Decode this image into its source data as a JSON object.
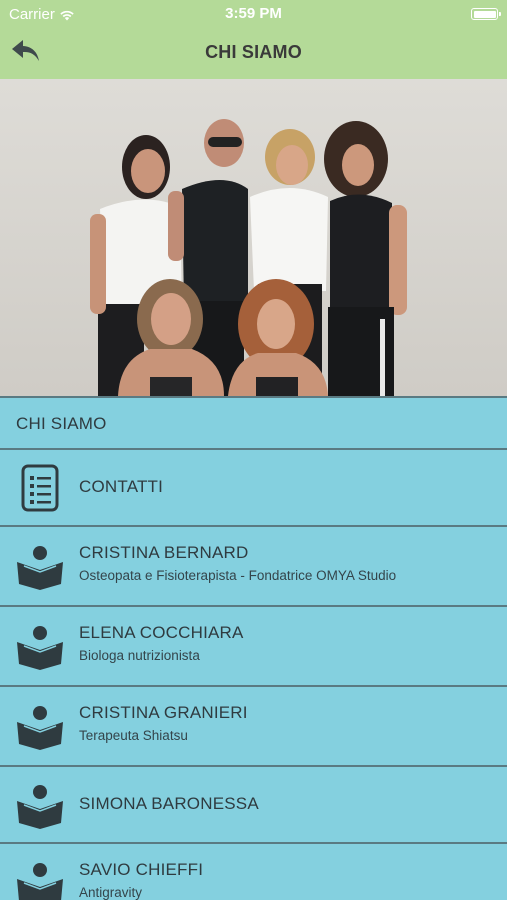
{
  "status": {
    "carrier": "Carrier",
    "time": "3:59 PM"
  },
  "nav": {
    "title": "CHI SIAMO"
  },
  "photo": {
    "description_icon": "team-photo"
  },
  "list": {
    "section_header": "CHI SIAMO",
    "items": [
      {
        "label": "CONTATTI",
        "subtitle": "",
        "icon": "document-list-icon"
      },
      {
        "label": "CRISTINA BERNARD",
        "subtitle": "Osteopata e Fisioterapista - Fondatrice OMYA Studio",
        "icon": "reader-icon"
      },
      {
        "label": "ELENA COCCHIARA",
        "subtitle": "Biologa nutrizionista",
        "icon": "reader-icon"
      },
      {
        "label": "CRISTINA GRANIERI",
        "subtitle": "Terapeuta Shiatsu",
        "icon": "reader-icon"
      },
      {
        "label": "SIMONA BARONESSA",
        "subtitle": "",
        "icon": "reader-icon"
      },
      {
        "label": "SAVIO CHIEFFI",
        "subtitle": "Antigravity",
        "icon": "reader-icon"
      }
    ]
  },
  "colors": {
    "header": "#b4da98",
    "list_bg": "#84d0df",
    "separator": "#5a7a82",
    "text": "#2f3b40"
  }
}
